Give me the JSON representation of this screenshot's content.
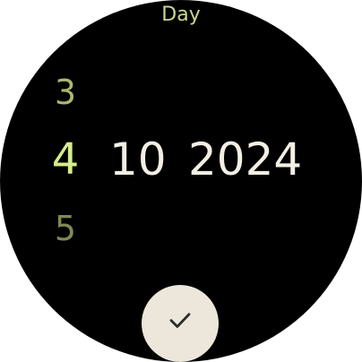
{
  "picker": {
    "field_label": "Day",
    "day": {
      "previous": "3",
      "current": "4",
      "next": "5"
    },
    "month": "10",
    "year": "2024"
  },
  "confirm": {
    "icon": "check-icon"
  },
  "colors": {
    "accent": "#d6ec8c",
    "text": "#f3efe4",
    "button_bg": "#ece7da"
  }
}
